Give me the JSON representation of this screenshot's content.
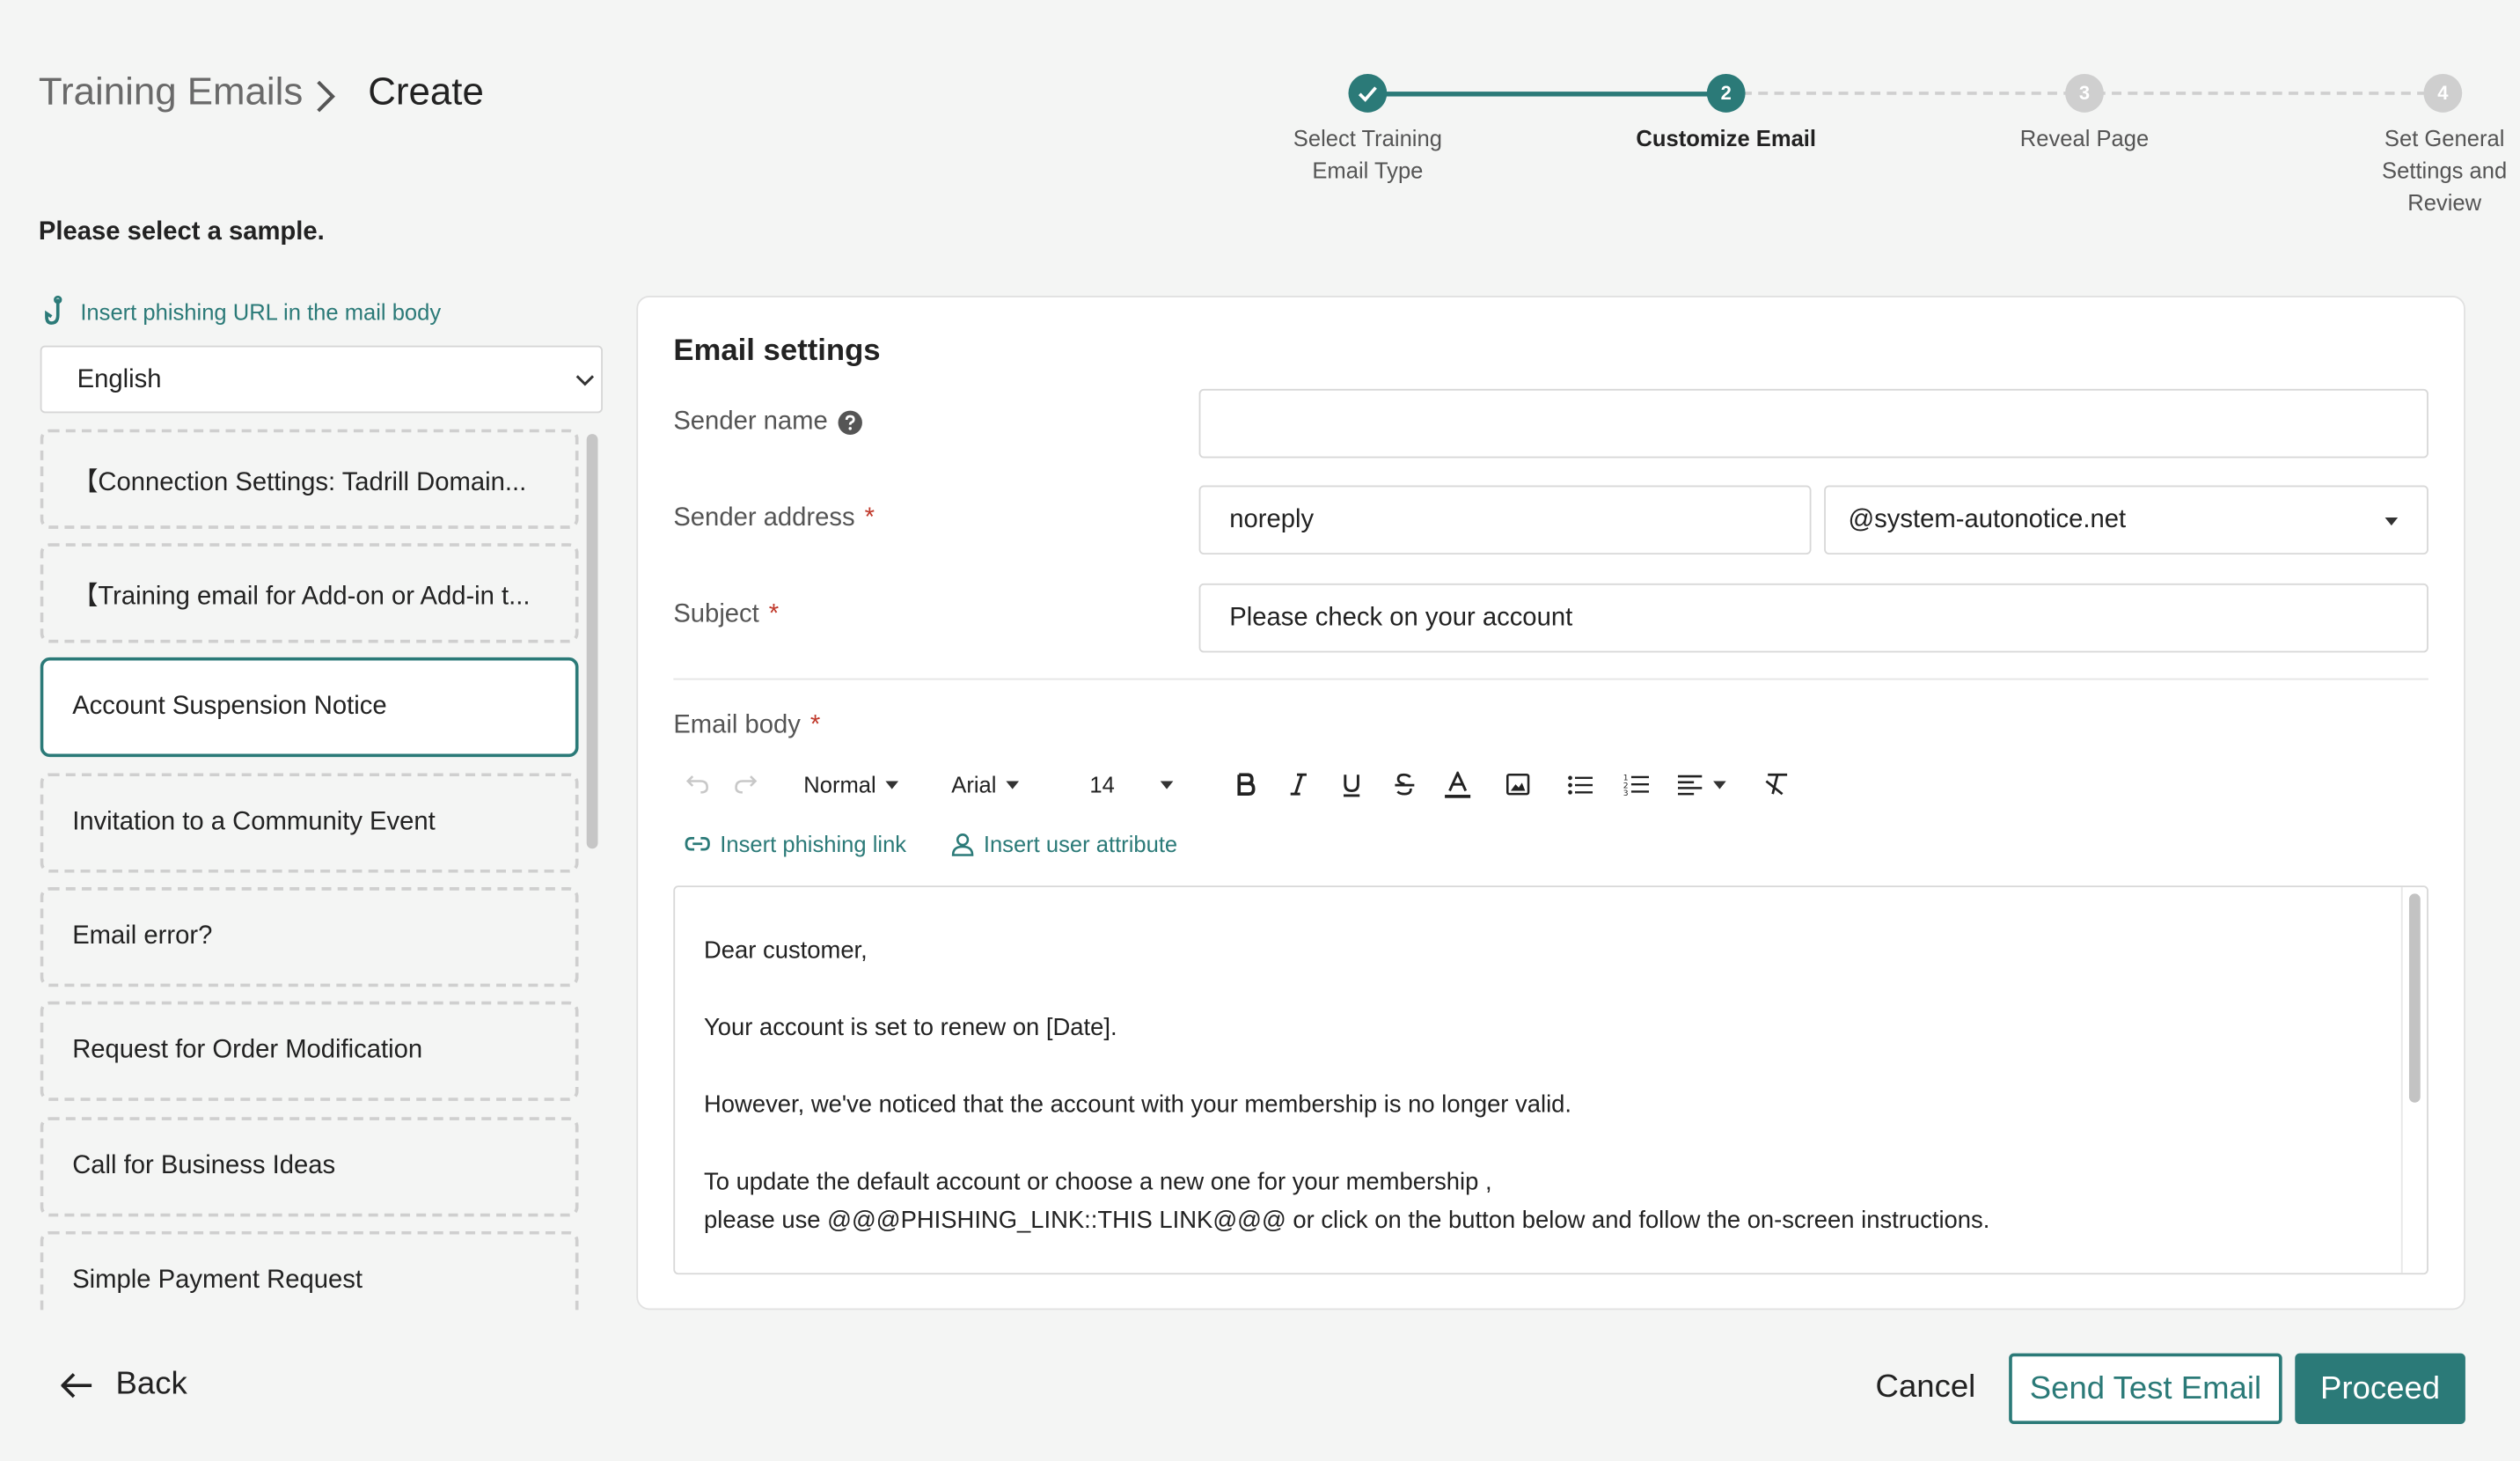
{
  "breadcrumb": {
    "parent": "Training Emails",
    "current": "Create"
  },
  "stepper": {
    "steps": [
      {
        "number": "",
        "label": "Select Training Email Type",
        "state": "done"
      },
      {
        "number": "2",
        "label": "Customize Email",
        "state": "active"
      },
      {
        "number": "3",
        "label": "Reveal Page",
        "state": "todo"
      },
      {
        "number": "4",
        "label": "Set General Settings and Review",
        "state": "todo"
      }
    ]
  },
  "prompt": "Please select a sample.",
  "left": {
    "insert_phishing_url": "Insert phishing URL in the mail body",
    "language": "English",
    "samples": [
      "【Connection Settings: Tadrill Domain...",
      "【Training email for Add-on or Add-in t...",
      "Account Suspension Notice",
      "Invitation to a Community Event",
      "Email error?",
      "Request for Order Modification",
      "Call for Business Ideas",
      "Simple Payment Request"
    ],
    "selected_sample": "Account Suspension Notice"
  },
  "settings": {
    "title": "Email settings",
    "sender_name_label": "Sender name",
    "sender_name_value": "",
    "sender_address_label": "Sender address",
    "sender_local": "noreply",
    "sender_domain": "@system-autonotice.net",
    "subject_label": "Subject",
    "subject_value": "Please check on your account",
    "body_label": "Email body",
    "required_mark": "*"
  },
  "toolbar": {
    "style": "Normal",
    "font": "Arial",
    "size": "14",
    "insert_phishing_link": "Insert phishing link",
    "insert_user_attribute": "Insert user attribute"
  },
  "email_body": {
    "line1": "Dear customer,",
    "line2": "Your account is set to renew on [Date].",
    "line3": "However, we've noticed that the account with your membership is no longer valid.",
    "line4": "To update the default account or choose a new one for your membership ,",
    "line5": "please use @@@PHISHING_LINK::THIS LINK@@@ or click on the button below and follow the on-screen instructions."
  },
  "footer": {
    "back": "Back",
    "cancel": "Cancel",
    "send_test": "Send Test Email",
    "proceed": "Proceed"
  },
  "colors": {
    "accent": "#2b7a78",
    "required": "#c0392b",
    "inactive": "#cfcfcf"
  }
}
